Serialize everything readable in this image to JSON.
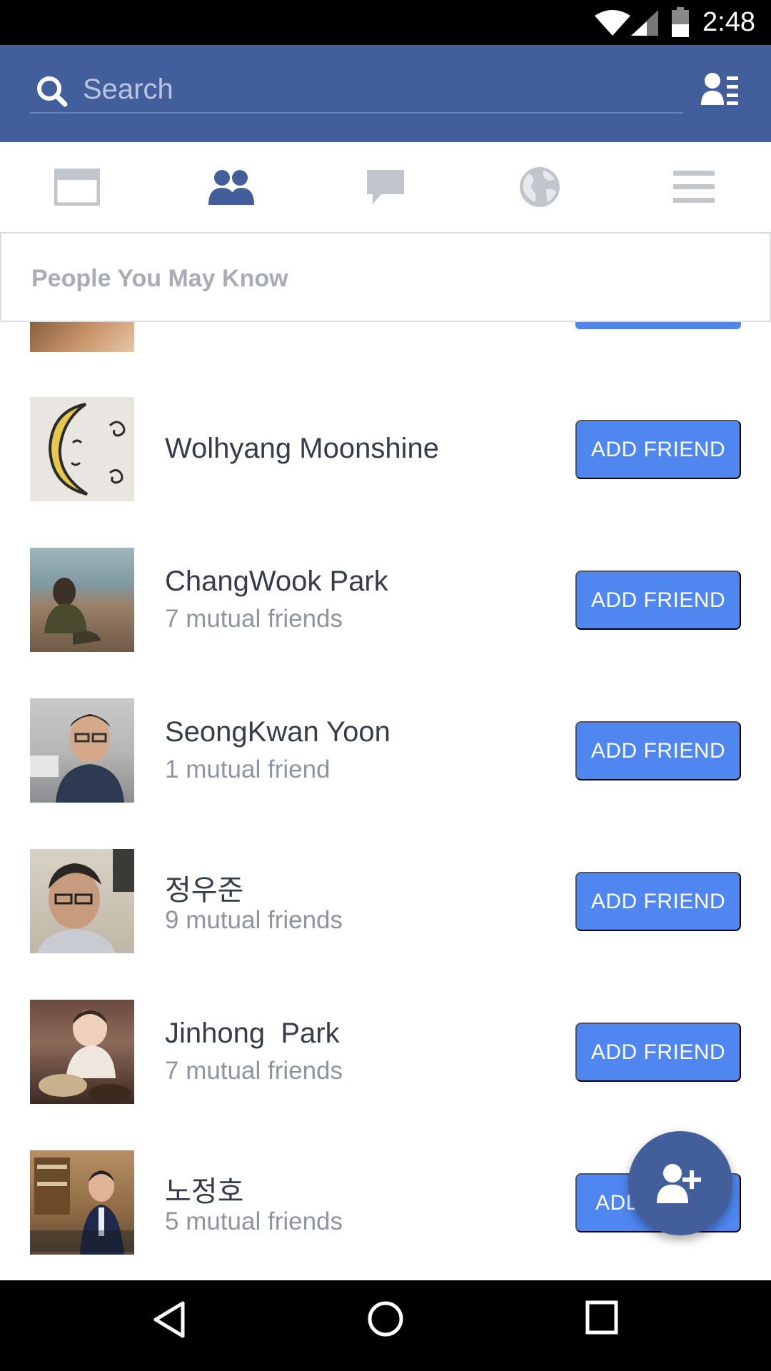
{
  "status_bar": {
    "time": "2:48"
  },
  "search": {
    "placeholder": "Search"
  },
  "tabs": [
    "news-feed",
    "friend-requests",
    "messages",
    "notifications",
    "more"
  ],
  "section": {
    "title": "People You May Know"
  },
  "people": [
    {
      "name": "Wolhyang Moonshine",
      "mutual": "",
      "button": "ADD FRIEND"
    },
    {
      "name": "ChangWook Park",
      "mutual": "7 mutual friends",
      "button": "ADD FRIEND"
    },
    {
      "name": "SeongKwan Yoon",
      "mutual": "1 mutual friend",
      "button": "ADD FRIEND"
    },
    {
      "name": "정우준",
      "mutual": "9 mutual friends",
      "button": "ADD FRIEND"
    },
    {
      "name": "Jinhong  Park",
      "mutual": "7 mutual friends",
      "button": "ADD FRIEND"
    },
    {
      "name": "노정호",
      "mutual": "5 mutual friends",
      "button": "ADD"
    }
  ],
  "icons": {
    "search": "search-icon",
    "friends_list": "friends-list-icon",
    "fab": "add-friend-icon",
    "back": "back-icon",
    "home": "home-icon",
    "recents": "recents-icon"
  },
  "colors": {
    "brand": "#425f9c",
    "button": "#4f86f0"
  }
}
